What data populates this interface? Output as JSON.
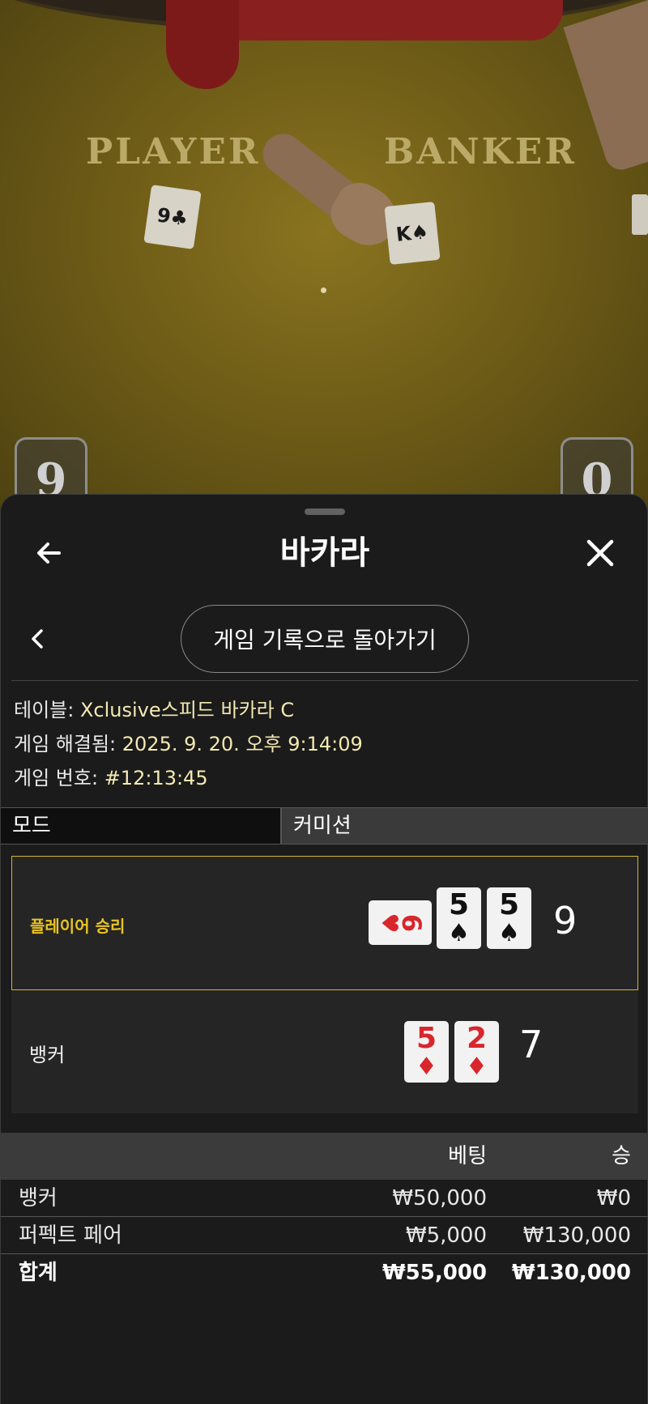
{
  "video": {
    "player_label": "PLAYER",
    "banker_label": "BANKER",
    "table_cards": [
      {
        "rank": "9",
        "suit": "♣"
      },
      {
        "rank": "K",
        "suit": "♠"
      }
    ],
    "player_score": "9",
    "banker_score": "0"
  },
  "header": {
    "title": "바카라"
  },
  "history_button": "게임 기록으로 돌아가기",
  "info": {
    "table_label": "테이블:",
    "table_value": "Xclusive스피드 바카라 C",
    "resolved_label": "게임 해결됨:",
    "resolved_value": "2025. 9. 20. 오후 9:14:09",
    "number_label": "게임 번호:",
    "number_value": "#12:13:45"
  },
  "tabs": {
    "mode": "모드",
    "commission": "커미션"
  },
  "results": {
    "player": {
      "label": "플레이어 승리",
      "score": "9",
      "cards": [
        {
          "rank": "6",
          "suit": "♥",
          "color": "#d8262c",
          "orientation": "sideways"
        },
        {
          "rank": "5",
          "suit": "♠",
          "color": "#111111"
        },
        {
          "rank": "5",
          "suit": "♠",
          "color": "#111111"
        }
      ]
    },
    "banker": {
      "label": "뱅커",
      "score": "7",
      "cards": [
        {
          "rank": "5",
          "suit": "♦",
          "color": "#d8262c"
        },
        {
          "rank": "2",
          "suit": "♦",
          "color": "#d8262c"
        }
      ]
    }
  },
  "bets": {
    "header": {
      "bet": "베팅",
      "win": "승"
    },
    "rows": [
      {
        "name": "뱅커",
        "bet": "₩50,000",
        "win": "₩0"
      },
      {
        "name": "퍼펙트 페어",
        "bet": "₩5,000",
        "win": "₩130,000"
      }
    ],
    "total": {
      "name": "합계",
      "bet": "₩55,000",
      "win": "₩130,000"
    }
  },
  "colors": {
    "winner_highlight": "#d4b728",
    "info_value": "#f3e9b2",
    "sheet_background": "#1b1b1b"
  }
}
